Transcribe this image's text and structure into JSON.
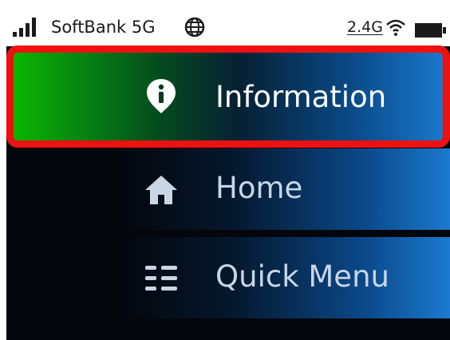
{
  "status_bar": {
    "carrier": "SoftBank 5G",
    "band": "2.4G",
    "icons": [
      "signal-icon",
      "globe-icon",
      "wifi-icon",
      "battery-icon"
    ]
  },
  "menu": {
    "items": [
      {
        "label": "Information",
        "icon": "info-location-icon",
        "selected": true
      },
      {
        "label": "Home",
        "icon": "home-icon",
        "selected": false
      },
      {
        "label": "Quick Menu",
        "icon": "menu-list-icon",
        "selected": false
      }
    ]
  },
  "colors": {
    "highlight": "#ee1111",
    "selected_start": "#08b800",
    "accent_blue": "#1b7ad0",
    "background": "#04060c"
  }
}
